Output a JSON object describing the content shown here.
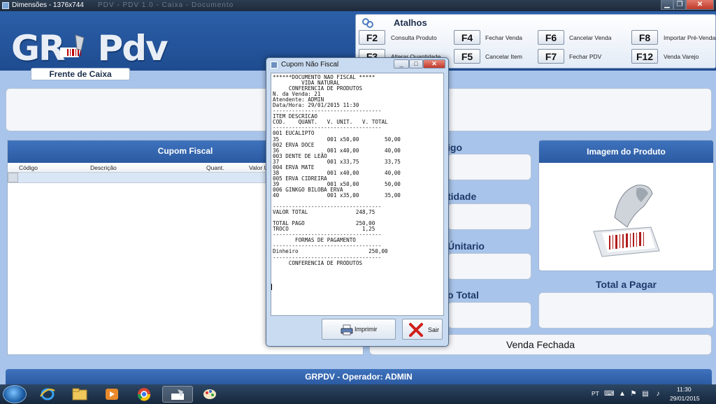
{
  "window": {
    "title": "Dimensões - 1376x744",
    "faded_titles": "PDV - PDV 1.0 - Caixa   -   Documento",
    "min_label": "▁",
    "max_label": "❐",
    "close_label": "✕"
  },
  "brand": {
    "logo_left": "GR",
    "logo_right": "Pdv",
    "subtitle": "Frente de Caixa"
  },
  "atalhos": {
    "title": "Atalhos",
    "shortcuts": [
      {
        "key": "F2",
        "label": "Consulta Produto"
      },
      {
        "key": "F4",
        "label": "Fechar Venda"
      },
      {
        "key": "F6",
        "label": "Cancelar Venda"
      },
      {
        "key": "F8",
        "label": "Importar Pré-Vendas"
      },
      {
        "key": "F3",
        "label": "Alterar Quantidade"
      },
      {
        "key": "F5",
        "label": "Cancelar Item"
      },
      {
        "key": "F7",
        "label": "Fechar PDV"
      },
      {
        "key": "F12",
        "label": "Venda Varejo"
      }
    ]
  },
  "cupom_fiscal": {
    "title": "Cupom Fiscal",
    "columns": [
      "Código",
      "Descrição",
      "Quant.",
      "Valor U"
    ]
  },
  "fields": {
    "codigo": "igo",
    "quantidade": "tidade",
    "valor_unitario": "Únitario",
    "valor_total": "o Total"
  },
  "image_panel": {
    "title": "Imagem do Produto"
  },
  "total_a_pagar": "Total a Pagar",
  "status": "Venda Fechada",
  "footer": "GRPDV - Operador: ADMIN",
  "dialog": {
    "title": "Cupom Não Fiscal",
    "receipt_lines": [
      "******DOCUMENTO NAO FISCAL *****",
      "         VIDA NATURAL",
      "     CONFERENCIA DE PRODUTOS",
      "N. da Venda: 21",
      "Atendente: ADMIN",
      "Data/Hora: 29/01/2015 11:30",
      "----------------------------------",
      "ITEM DESCRICAO",
      "COD.    QUANT.   V. UNIT.   V. TOTAL",
      "----------------------------------",
      "001 EUCALIPTO",
      "35               001 x50,00        50,00",
      "002 ERVA DOCE",
      "36               001 x40,00        40,00",
      "003 DENTE DE LEÃO",
      "37               001 x33,75        33,75",
      "004 ERVA MATE",
      "38               001 x40,00        40,00",
      "005 ERVA CIDREIRA",
      "39               001 x50,00        50,00",
      "006 GINKGO BILOBA ERVA",
      "40               001 x35,00        35,00",
      "",
      "----------------------------------",
      "VALOR TOTAL               248,75",
      "",
      "TOTAL PAGO                250,00",
      "TROCO                       1,25",
      "----------------------------------",
      "       FORMAS DE PAGAMENTO",
      "----------------------------------",
      "Dinheiro                      250,00",
      "----------------------------------",
      "     CONFERENCIA DE PRODUTOS"
    ],
    "print_label": "Imprimir",
    "exit_label": "Sair"
  },
  "taskbar": {
    "lang": "PT",
    "time": "11:30",
    "date": "29/01/2015"
  }
}
